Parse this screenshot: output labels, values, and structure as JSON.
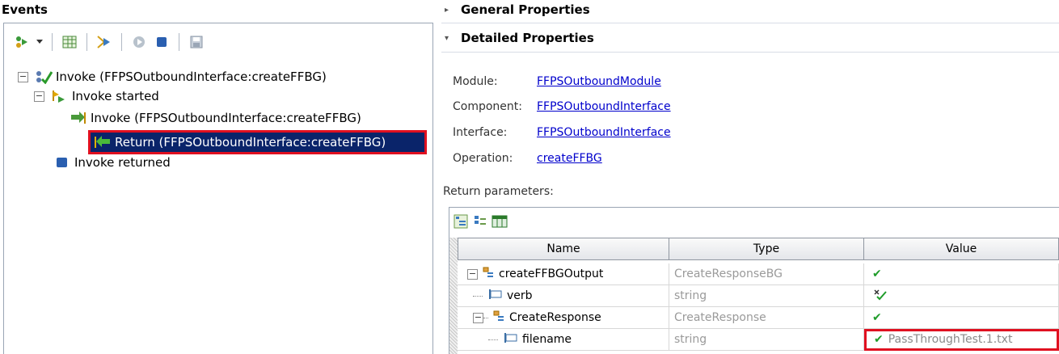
{
  "events": {
    "title": "Events",
    "tree": {
      "root_label": "Invoke (FFPSOutboundInterface:createFFBG)",
      "started_label": "Invoke started",
      "invoke_label": "Invoke (FFPSOutboundInterface:createFFBG)",
      "return_label": "Return (FFPSOutboundInterface:createFFBG)",
      "returned_label": "Invoke returned",
      "expander_minus": "⊟"
    },
    "toolbar": {
      "icons": [
        "run-events-icon",
        "dropdown-arrow-icon",
        "table-icon",
        "step-icon",
        "play-icon",
        "stop-icon",
        "save-icon"
      ]
    }
  },
  "general": {
    "title": "General Properties",
    "triangle": "▸"
  },
  "detailed": {
    "title": "Detailed Properties",
    "triangle": "▾",
    "module_label": "Module:",
    "module_value": "FFPSOutboundModule",
    "component_label": "Component:",
    "component_value": "FFPSOutboundInterface",
    "interface_label": "Interface:",
    "interface_value": "FFPSOutboundInterface",
    "operation_label": "Operation:",
    "operation_value": "createFFBG"
  },
  "return_params": {
    "label": "Return parameters:",
    "columns": [
      "Name",
      "Type",
      "Value"
    ],
    "rows": [
      {
        "name": "createFFBGOutput",
        "type": "CreateResponseBG",
        "value": "✔"
      },
      {
        "name": "verb",
        "type": "string",
        "value": "✔"
      },
      {
        "name": "CreateResponse",
        "type": "CreateResponse",
        "value": "✔"
      },
      {
        "name": "filename",
        "type": "string",
        "value": "PassThroughTest.1.txt"
      }
    ]
  },
  "colors": {
    "selection": "#0a246a",
    "highlight_outline": "#e01020",
    "link": "#0000cc",
    "check": "#1f9c2a"
  }
}
